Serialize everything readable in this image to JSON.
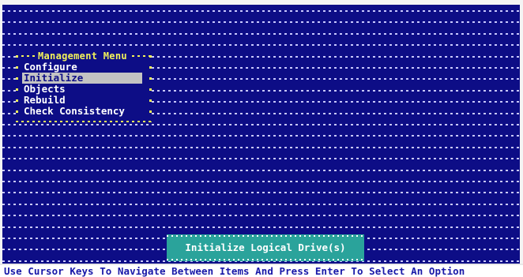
{
  "management_menu": {
    "title": "Management Menu",
    "items": [
      {
        "label": "Configure",
        "selected": false
      },
      {
        "label": "Initialize",
        "selected": true
      },
      {
        "label": "Objects",
        "selected": false
      },
      {
        "label": "Rebuild",
        "selected": false
      },
      {
        "label": "Check Consistency",
        "selected": false
      }
    ]
  },
  "info_box": {
    "text": "Initialize Logical Drive(s)"
  },
  "status_bar": {
    "text": "Use Cursor Keys To Navigate Between Items And Press Enter To Select An Option"
  },
  "colors": {
    "background": "#0d0d86",
    "menu_border": "#f2f25a",
    "selection": "#c3c3c3",
    "info_box": "#2aa39b",
    "status_text": "#1818a8"
  }
}
